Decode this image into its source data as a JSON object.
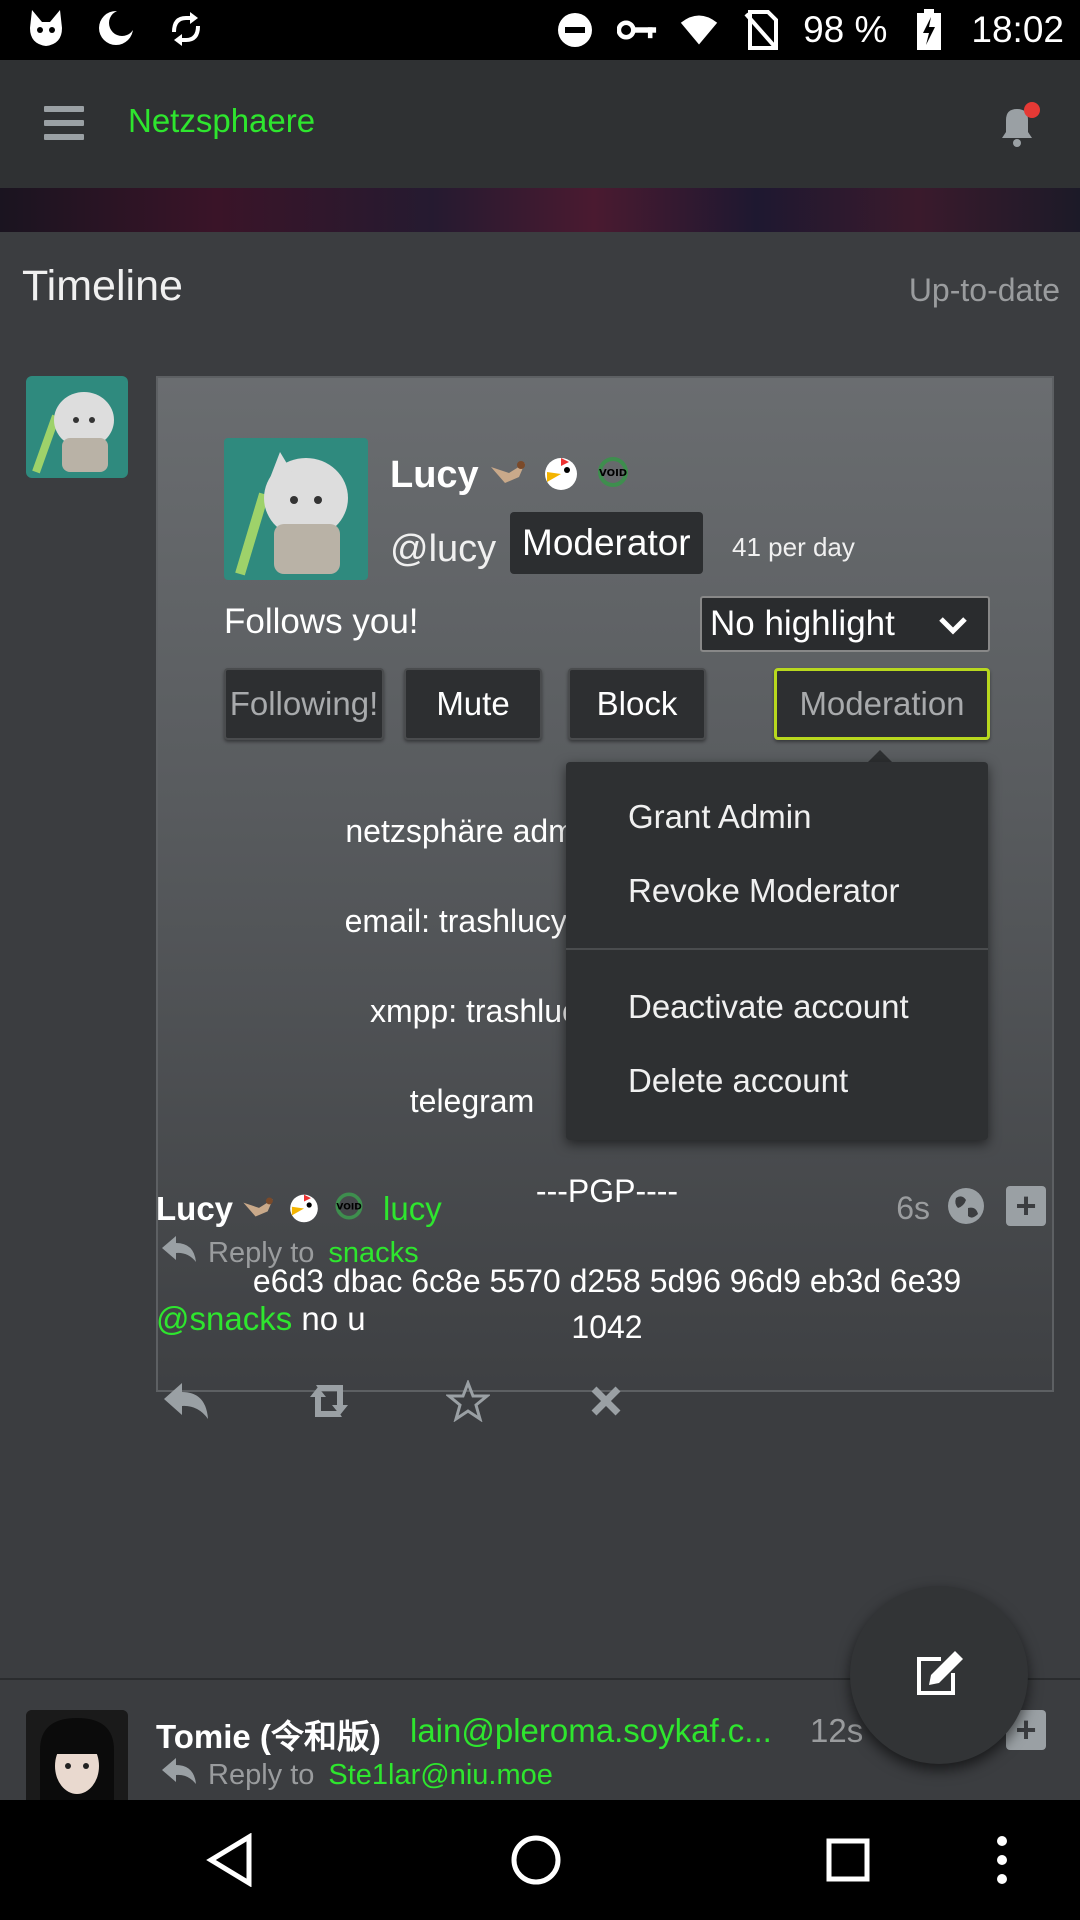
{
  "status_bar": {
    "battery": "98 %",
    "time": "18:02",
    "left_icons": [
      "app-icon",
      "moon-icon",
      "sync-icon"
    ],
    "right_icons": [
      "do-not-disturb-icon",
      "key-icon",
      "wifi-icon",
      "no-sim-icon",
      "battery-icon"
    ]
  },
  "app_bar": {
    "title": "Netzsphaere",
    "accent_color": "#2ee62e",
    "notification_dot_color": "#e53935"
  },
  "timeline": {
    "title": "Timeline",
    "status": "Up-to-date"
  },
  "profile": {
    "name": "Lucy",
    "handle": "@lucy",
    "badge": "Moderator",
    "posts_per_day": "41 per day",
    "follows_you": "Follows you!",
    "highlight_select": "No highlight",
    "buttons": {
      "following": "Following!",
      "mute": "Mute",
      "block": "Block",
      "moderation": "Moderation"
    },
    "bio_lines": [
      "netzsphäre admin,",
      "email: trashlucy@",
      "xmpp: trashluc",
      "telegram",
      "---PGP----",
      "e6d3 dbac 6c8e 5570 d258 5d96 96d9 eb3d 6e39",
      "1042"
    ]
  },
  "moderation_menu": {
    "items": [
      "Grant Admin",
      "Revoke Moderator",
      "Deactivate account",
      "Delete account"
    ]
  },
  "posts": [
    {
      "name": "Lucy",
      "user": "lucy",
      "time": "6s",
      "reply_label": "Reply to",
      "reply_to": "snacks",
      "mention": "@snacks",
      "text": " no u"
    },
    {
      "name": "Tomie (令和版)",
      "user": "lain@pleroma.soykaf.c...",
      "time": "12s",
      "reply_label": "Reply to",
      "reply_to": "Ste1lar@niu.moe"
    }
  ]
}
